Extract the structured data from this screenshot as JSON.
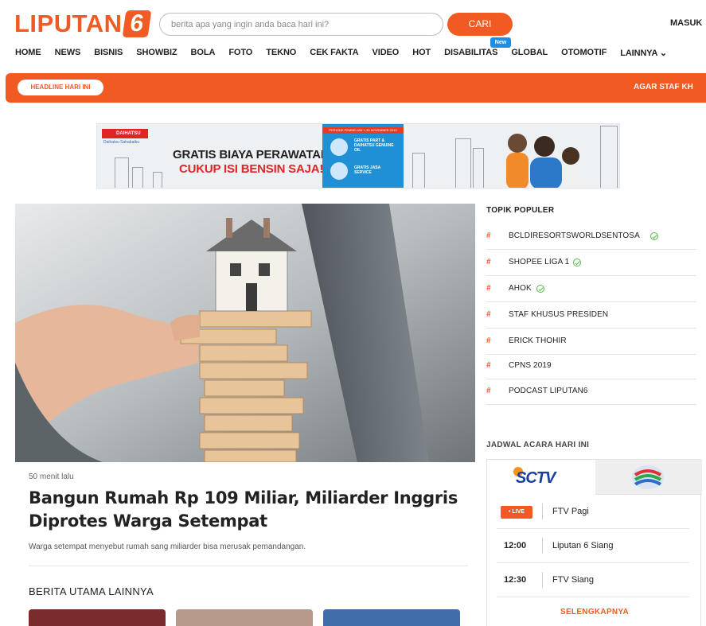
{
  "header": {
    "logo_text": "LIPUTAN",
    "logo_number": "6",
    "search_placeholder": "berita apa yang ingin anda baca hari ini?",
    "search_button": "CARI",
    "login": "MASUK"
  },
  "nav": {
    "items": [
      "HOME",
      "NEWS",
      "BISNIS",
      "SHOWBIZ",
      "BOLA",
      "FOTO",
      "TEKNO",
      "CEK FAKTA",
      "VIDEO",
      "HOT",
      "DISABILITAS",
      "GLOBAL",
      "OTOMOTIF",
      "LAINNYA ⌄"
    ],
    "new_badge": "New"
  },
  "headline": {
    "label": "HEADLINE HARI INI",
    "ticker": "AGAR STAF KH"
  },
  "ad": {
    "brand": "DAIHATSU",
    "tagline": "Daihatsu Sahabatku",
    "line1": "GRATIS BIAYA PERAWATAN,",
    "line2": "CUKUP ISI BENSIN SAJA!*",
    "panel_top": "PERIODE PEMBELIAN 1-30 NOVEMBER 2019",
    "panel_text1": "GRATIS PART & DAIHATSU GENUINE OIL",
    "panel_text2": "GRATIS JASA SERVICE",
    "colors": {
      "accent": "#1f8fd6",
      "red": "#e02424"
    }
  },
  "article": {
    "time": "50 menit lalu",
    "title": "Bangun Rumah Rp 109 Miliar, Miliarder Inggris Diprotes Warga Setempat",
    "description": "Warga setempat menyebut rumah sang miliarder bisa merusak pemandangan."
  },
  "more_news": {
    "title": "BERITA UTAMA LAINNYA"
  },
  "sidebar": {
    "topics_title": "TOPIK POPULER",
    "topics": [
      {
        "hash": "#",
        "label": "BCLDIRESORTSWORLDSENTOSA",
        "verified": true
      },
      {
        "hash": "#",
        "label": "SHOPEE LIGA 1",
        "verified": true
      },
      {
        "hash": "#",
        "label": "AHOK",
        "verified": true
      },
      {
        "hash": "#",
        "label": "STAF KHUSUS PRESIDEN",
        "verified": false
      },
      {
        "hash": "#",
        "label": "ERICK THOHIR",
        "verified": false
      },
      {
        "hash": "#",
        "label": "CPNS 2019",
        "verified": false
      },
      {
        "hash": "#",
        "label": "PODCAST LIPUTAN6",
        "verified": false
      }
    ],
    "schedule_title": "JADWAL ACARA HARI INI",
    "channel_active": "SCTV",
    "schedule": [
      {
        "time": "• LIVE",
        "program": "FTV Pagi",
        "live": true
      },
      {
        "time": "12:00",
        "program": "Liputan 6 Siang",
        "live": false
      },
      {
        "time": "12:30",
        "program": "FTV Siang",
        "live": false
      }
    ],
    "more": "SELENGKAPNYA"
  },
  "colors": {
    "brand": "#f15a23",
    "verified": "#54b948"
  }
}
